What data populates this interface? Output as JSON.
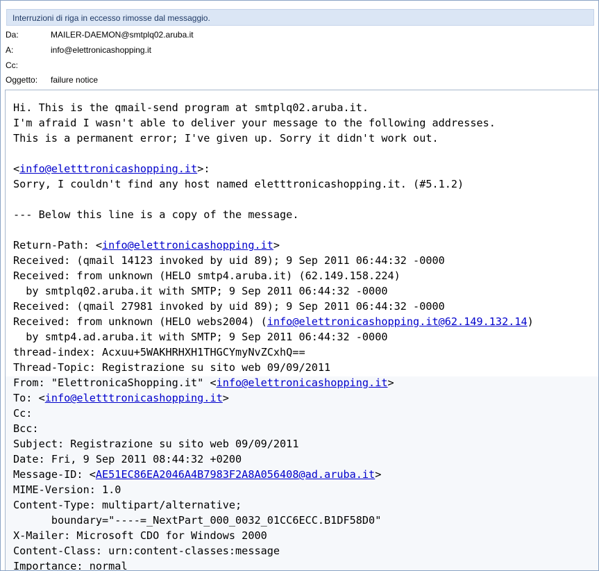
{
  "infobar": {
    "text": "Interruzioni di riga in eccesso rimosse dal messaggio."
  },
  "headers": [
    {
      "label": "Da:",
      "value": "MAILER-DAEMON@smtplq02.aruba.it"
    },
    {
      "label": "A:",
      "value": "info@elettronicashopping.it"
    },
    {
      "label": "Cc:",
      "value": ""
    },
    {
      "label": "Oggetto:",
      "value": "failure notice"
    }
  ],
  "body": {
    "l01": "Hi. This is the qmail-send program at smtplq02.aruba.it.",
    "l02": "I'm afraid I wasn't able to deliver your message to the following addresses.",
    "l03": "This is a permanent error; I've given up. Sorry it didn't work out.",
    "l05a": "<",
    "l05link": "info@eletttronicashopping.it",
    "l05b": ">:",
    "l06": "Sorry, I couldn't find any host named eletttronicashopping.it. (#5.1.2)",
    "l08": "--- Below this line is a copy of the message.",
    "l10a": "Return-Path: <",
    "l10link": "info@elettronicashopping.it",
    "l10b": ">",
    "l11": "Received: (qmail 14123 invoked by uid 89); 9 Sep 2011 06:44:32 -0000",
    "l12": "Received: from unknown (HELO smtp4.aruba.it) (62.149.158.224)",
    "l13": "  by smtplq02.aruba.it with SMTP; 9 Sep 2011 06:44:32 -0000",
    "l14": "Received: (qmail 27981 invoked by uid 89); 9 Sep 2011 06:44:32 -0000",
    "l15a": "Received: from unknown (HELO webs2004) (",
    "l15link": "info@elettronicashopping.it@62.149.132.14",
    "l15b": ")",
    "l16": "  by smtp4.ad.aruba.it with SMTP; 9 Sep 2011 06:44:32 -0000",
    "l17": "thread-index: Acxuu+5WAKHRHXH1THGCYmyNvZCxhQ==",
    "l18": "Thread-Topic: Registrazione su sito web 09/09/2011",
    "l19a": "From: \"ElettronicaShopping.it\" <",
    "l19link": "info@elettronicashopping.it",
    "l19b": ">",
    "l20a": "To: <",
    "l20link": "info@eletttronicashopping.it",
    "l20b": ">",
    "l21": "Cc:",
    "l22": "Bcc:",
    "l23": "Subject: Registrazione su sito web 09/09/2011",
    "l24": "Date: Fri, 9 Sep 2011 08:44:32 +0200",
    "l25a": "Message-ID: <",
    "l25link": "AE51EC86EA2046A4B7983F2A8A056408@ad.aruba.it",
    "l25b": ">",
    "l26": "MIME-Version: 1.0",
    "l27": "Content-Type: multipart/alternative;",
    "l28": "      boundary=\"----=_NextPart_000_0032_01CC6ECC.B1DF58D0\"",
    "l29": "X-Mailer: Microsoft CDO for Windows 2000",
    "l30": "Content-Class: urn:content-classes:message",
    "l31": "Importance: normal"
  },
  "colors": {
    "highlight": "#f3ff3a",
    "link": "#0000cc",
    "infobar": "#dbe6f5"
  }
}
